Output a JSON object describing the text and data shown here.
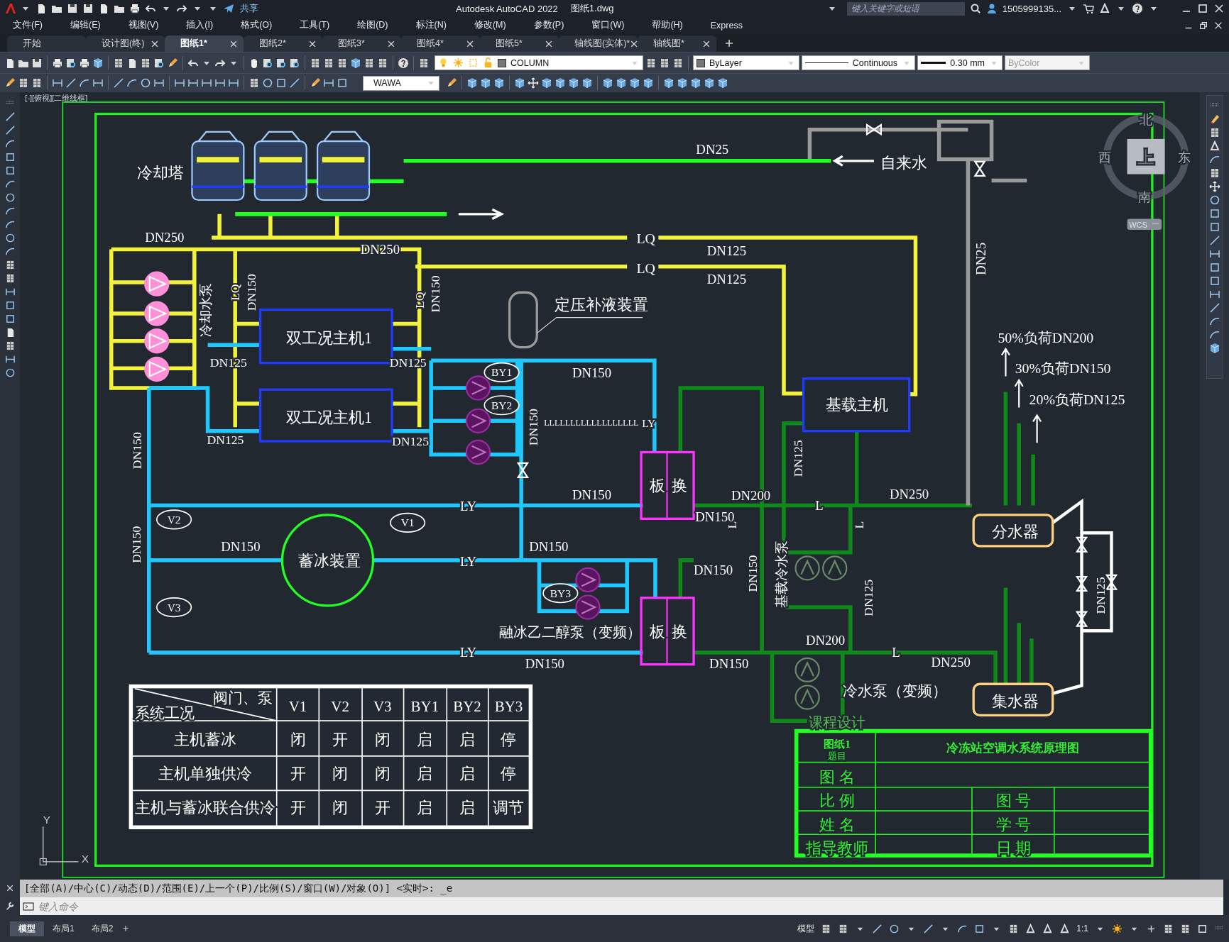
{
  "window": {
    "title": "Autodesk AutoCAD 2022",
    "file": "图纸1.dwg"
  },
  "quick_access": {
    "share": "共享"
  },
  "search": {
    "placeholder": "键入关键字或短语"
  },
  "account": {
    "user": "1505999135..."
  },
  "menu": [
    "文件(F)",
    "编辑(E)",
    "视图(V)",
    "插入(I)",
    "格式(O)",
    "工具(T)",
    "绘图(D)",
    "标注(N)",
    "修改(M)",
    "参数(P)",
    "窗口(W)",
    "帮助(H)",
    "Express"
  ],
  "tabs": [
    {
      "label": "开始",
      "selected": false,
      "closable": false
    },
    {
      "label": "设计图(终)",
      "selected": false,
      "closable": true
    },
    {
      "label": "图纸1*",
      "selected": true,
      "closable": true
    },
    {
      "label": "图纸2*",
      "selected": false,
      "closable": true
    },
    {
      "label": "图纸3*",
      "selected": false,
      "closable": true
    },
    {
      "label": "图纸4*",
      "selected": false,
      "closable": true
    },
    {
      "label": "图纸5*",
      "selected": false,
      "closable": true
    },
    {
      "label": "轴线图(实体)*",
      "selected": false,
      "closable": true
    },
    {
      "label": "轴线图*",
      "selected": false,
      "closable": true
    }
  ],
  "layer_control": {
    "value": "COLUMN"
  },
  "properties": [
    {
      "kind": "color",
      "value": "ByLayer",
      "disabled": false
    },
    {
      "kind": "linetype",
      "value": "Continuous",
      "disabled": false
    },
    {
      "kind": "lineweight",
      "value": "0.30 mm",
      "disabled": false
    },
    {
      "kind": "plotstyle",
      "value": "ByColor",
      "disabled": true
    }
  ],
  "dim_style": {
    "value": "WAWA"
  },
  "viewport": {
    "label": "[-][俯视][二维线框]"
  },
  "viewcube": {
    "north": "北",
    "west": "西",
    "east": "东",
    "south": "南",
    "top": "上",
    "ucs": "WCS"
  },
  "ucs_icon": {
    "y": "Y",
    "x": "X"
  },
  "drawing": {
    "labels": [
      {
        "text": "冷却塔",
        "kind": "label"
      },
      {
        "text": "DN25",
        "kind": "label"
      },
      {
        "text": "自来水",
        "kind": "label"
      },
      {
        "text": "DN250",
        "kind": "label"
      },
      {
        "text": "LQ",
        "kind": "label"
      },
      {
        "text": "DN250",
        "kind": "label"
      },
      {
        "text": "DN125",
        "kind": "label"
      },
      {
        "text": "LQ",
        "kind": "label"
      },
      {
        "text": "DN125",
        "kind": "label"
      },
      {
        "text": "DN25",
        "kind": "vertical"
      },
      {
        "text": "LQ",
        "kind": "vertical"
      },
      {
        "text": "DN150",
        "kind": "vertical"
      },
      {
        "text": "LQ",
        "kind": "vertical"
      },
      {
        "text": "DN150",
        "kind": "vertical"
      },
      {
        "text": "冷却水泵",
        "kind": "vertical"
      },
      {
        "text": "定压补液装置",
        "kind": "label"
      },
      {
        "text": "双工况主机1",
        "kind": "label"
      },
      {
        "text": "DN125",
        "kind": "label"
      },
      {
        "text": "DN125",
        "kind": "label"
      },
      {
        "text": "BY1",
        "kind": "tag"
      },
      {
        "text": "BY2",
        "kind": "tag"
      },
      {
        "text": "DN150",
        "kind": "label"
      },
      {
        "text": "双工况主机1",
        "kind": "label"
      },
      {
        "text": "基载主机",
        "kind": "label"
      },
      {
        "text": "50%负荷DN200",
        "kind": "label"
      },
      {
        "text": "30%负荷DN150",
        "kind": "label"
      },
      {
        "text": "20%负荷DN125",
        "kind": "label"
      },
      {
        "text": "LLLLLLLLLLLLLLLLLL",
        "kind": "label"
      },
      {
        "text": "LY",
        "kind": "label"
      },
      {
        "text": "DN150",
        "kind": "vertical"
      },
      {
        "text": "DN125",
        "kind": "label"
      },
      {
        "text": "DN125",
        "kind": "label"
      },
      {
        "text": "DN150",
        "kind": "vertical"
      },
      {
        "text": "DN125",
        "kind": "vertical"
      },
      {
        "text": "板",
        "kind": "label"
      },
      {
        "text": "换",
        "kind": "label"
      },
      {
        "text": "DN150",
        "kind": "label"
      },
      {
        "text": "LY",
        "kind": "label"
      },
      {
        "text": "V1",
        "kind": "tag"
      },
      {
        "text": "V2",
        "kind": "tag"
      },
      {
        "text": "DN200",
        "kind": "label"
      },
      {
        "text": "L",
        "kind": "label"
      },
      {
        "text": "DN250",
        "kind": "label"
      },
      {
        "text": "DN150",
        "kind": "label"
      },
      {
        "text": "分水器",
        "kind": "label"
      },
      {
        "text": "DN150",
        "kind": "vertical"
      },
      {
        "text": "DN150",
        "kind": "label"
      },
      {
        "text": "蓄冰装置",
        "kind": "label"
      },
      {
        "text": "LY",
        "kind": "label"
      },
      {
        "text": "DN150",
        "kind": "label"
      },
      {
        "text": "L",
        "kind": "vertical"
      },
      {
        "text": "L",
        "kind": "vertical"
      },
      {
        "text": "DN150",
        "kind": "label"
      },
      {
        "text": "DN150",
        "kind": "vertical"
      },
      {
        "text": "基载冷水泵",
        "kind": "vertical"
      },
      {
        "text": "BY3",
        "kind": "tag"
      },
      {
        "text": "DN125",
        "kind": "vertical"
      },
      {
        "text": "DN125",
        "kind": "vertical"
      },
      {
        "text": "V3",
        "kind": "tag"
      },
      {
        "text": "融冰乙二醇泵（变频）",
        "kind": "label"
      },
      {
        "text": "板",
        "kind": "label"
      },
      {
        "text": "换",
        "kind": "label"
      },
      {
        "text": "LY",
        "kind": "label"
      },
      {
        "text": "DN150",
        "kind": "label"
      },
      {
        "text": "DN150",
        "kind": "label"
      },
      {
        "text": "DN200",
        "kind": "label"
      },
      {
        "text": "L",
        "kind": "label"
      },
      {
        "text": "DN250",
        "kind": "label"
      },
      {
        "text": "冷水泵（变频）",
        "kind": "label"
      },
      {
        "text": "集水器",
        "kind": "label"
      }
    ]
  },
  "table": {
    "header_top": "阀门、泵",
    "header_left": "系统工况",
    "columns": [
      "V1",
      "V2",
      "V3",
      "BY1",
      "BY2",
      "BY3"
    ],
    "rows": [
      {
        "label": "主机蓄冰",
        "cells": [
          "闭",
          "开",
          "闭",
          "启",
          "启",
          "停"
        ]
      },
      {
        "label": "主机单独供冷",
        "cells": [
          "开",
          "闭",
          "闭",
          "启",
          "启",
          "停"
        ]
      },
      {
        "label": "主机与蓄冰联合供冷",
        "cells": [
          "开",
          "闭",
          "开",
          "启",
          "启",
          "调节"
        ]
      }
    ]
  },
  "title_block": {
    "course": "课程设计",
    "sheet": "图纸1",
    "subject": "题目",
    "title": "冷冻站空调水系统原理图",
    "name_label": "图 名",
    "scale_label": "比 例",
    "drawing_no_label": "图 号",
    "student_label": "姓 名",
    "student_no_label": "学 号",
    "teacher_label": "指导教师",
    "date_label": "日 期"
  },
  "command": {
    "history": "[全部(A)/中心(C)/动态(D)/范围(E)/上一个(P)/比例(S)/窗口(W)/对象(O)] <实时>: _e",
    "placeholder": "键入命令"
  },
  "layout_tabs": [
    {
      "label": "模型",
      "selected": true
    },
    {
      "label": "布局1",
      "selected": false
    },
    {
      "label": "布局2",
      "selected": false
    }
  ],
  "status_bar": {
    "mode": "模型",
    "scale": "1:1"
  }
}
